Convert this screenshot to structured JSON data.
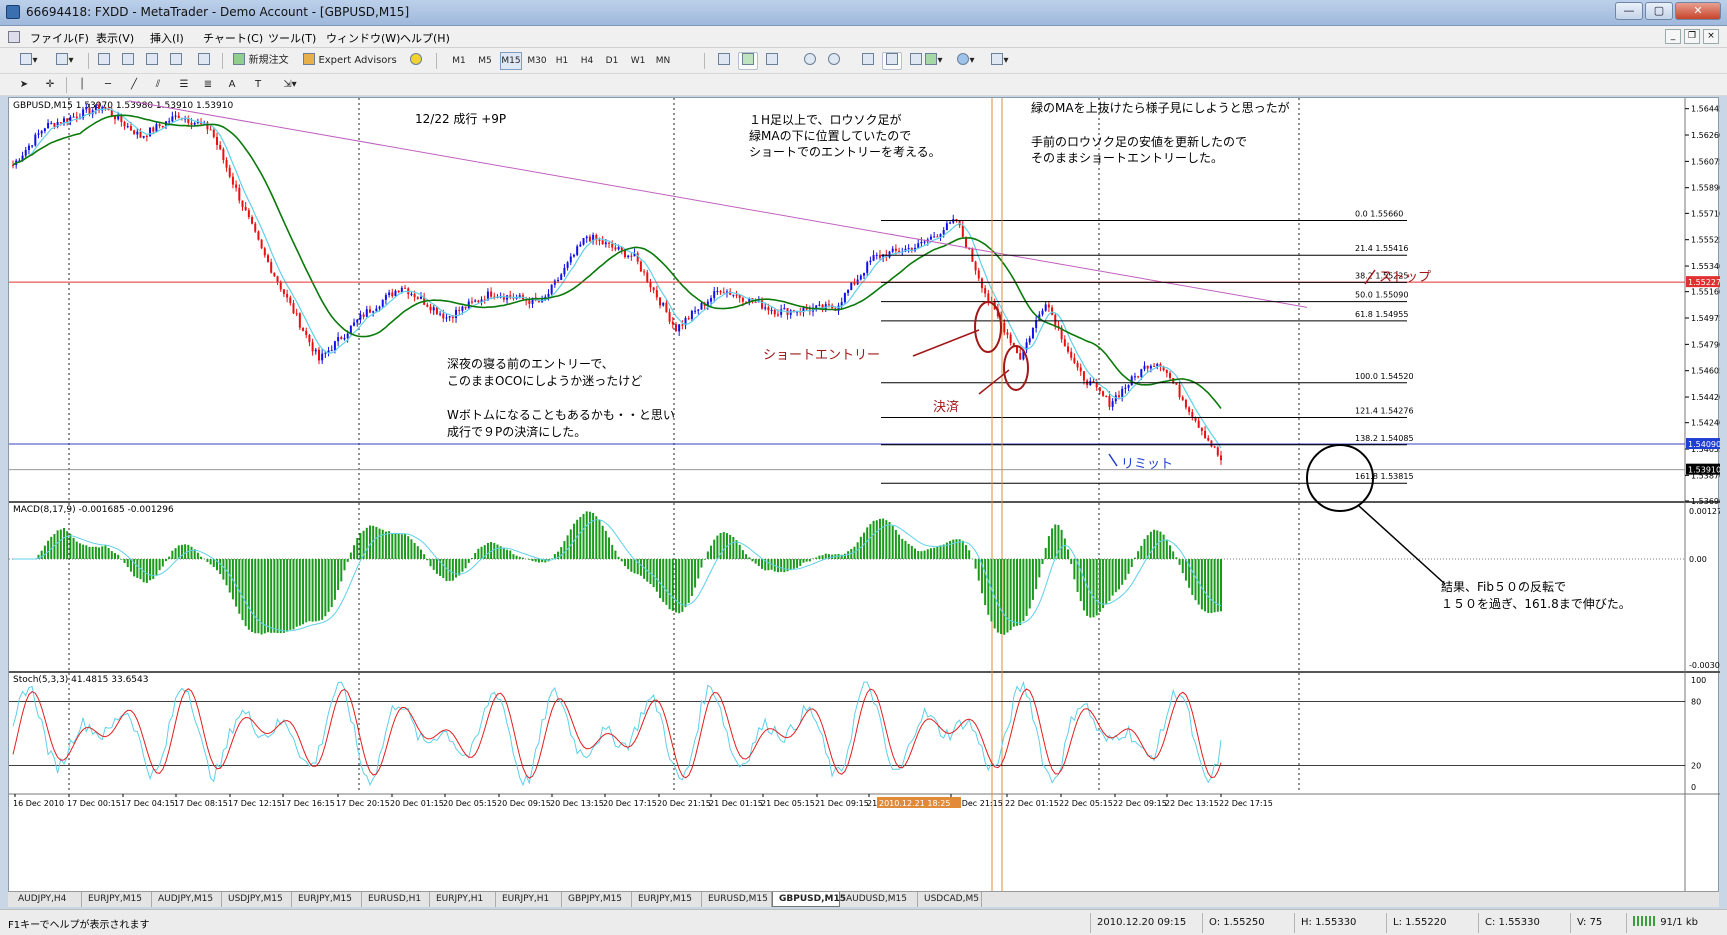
{
  "window": {
    "title": "66694418: FXDD - MetaTrader - Demo Account - [GBPUSD,M15]"
  },
  "menu": [
    "ファイル(F)",
    "表示(V)",
    "挿入(I)",
    "チャート(C)",
    "ツール(T)",
    "ウィンドウ(W)",
    "ヘルプ(H)"
  ],
  "toolbar": {
    "new_order": "新規注文",
    "expert_advisors": "Expert Advisors",
    "timeframes": [
      "M1",
      "M5",
      "M15",
      "M30",
      "H1",
      "H4",
      "D1",
      "W1",
      "MN"
    ],
    "active_timeframe": "M15"
  },
  "chart": {
    "main_header": "GBPUSD,M15  1.53970 1.53980 1.53910 1.53910",
    "macd_header": "MACD(8,17,9) -0.001685 -0.001296",
    "stoch_header": "Stoch(5,3,3) 41.4815 33.6543",
    "price_ticks": [
      "1.56445",
      "1.56260",
      "1.56075",
      "1.55890",
      "1.55710",
      "1.55525",
      "1.55340",
      "1.55160",
      "1.54975",
      "1.54790",
      "1.54605",
      "1.54420",
      "1.54240",
      "1.54055",
      "1.53870",
      "1.53690"
    ],
    "price_tags": {
      "stop": "1.55227",
      "limit": "1.54090",
      "current": "1.53910"
    },
    "macd_ticks": [
      "0.001276",
      "0.00",
      "-0.00302"
    ],
    "stoch_ticks": [
      "100",
      "80",
      "20",
      "0"
    ],
    "fib_levels": [
      {
        "pct": "0.0",
        "price": "1.55660"
      },
      {
        "pct": "21.4",
        "price": "1.55416"
      },
      {
        "pct": "38.2",
        "price": "1.55225"
      },
      {
        "pct": "50.0",
        "price": "1.55090"
      },
      {
        "pct": "61.8",
        "price": "1.54955"
      },
      {
        "pct": "100.0",
        "price": "1.54520"
      },
      {
        "pct": "121.4",
        "price": "1.54276"
      },
      {
        "pct": "138.2",
        "price": "1.54085"
      },
      {
        "pct": "161.8",
        "price": "1.53815"
      }
    ],
    "time_labels": [
      "16 Dec 2010",
      "17 Dec 00:15",
      "17 Dec 04:15",
      "17 Dec 08:15",
      "17 Dec 12:15",
      "17 Dec 16:15",
      "17 Dec 20:15",
      "20 Dec 01:15",
      "20 Dec 05:15",
      "20 Dec 09:15",
      "20 Dec 13:15",
      "20 Dec 17:15",
      "20 Dec 21:15",
      "21 Dec 01:15",
      "21 Dec 05:15",
      "21 Dec 09:15",
      "21 D",
      "22 Dec 21:15",
      "22 Dec 01:15",
      "22 Dec 05:15",
      "22 Dec 09:15",
      "22 Dec 13:15",
      "22 Dec 17:15"
    ],
    "cursor_time": "2010.12.21 18:25",
    "annotations": {
      "date_note": "12/22 成行  +9P",
      "reason": [
        "１H足以上で、ロウソク足が",
        "緑MAの下に位置していたので",
        "ショートでのエントリーを考える。"
      ],
      "plan": "緑のMAを上抜けたら様子見にしようと思ったが",
      "entry_reason": [
        "手前のロウソク足の安値を更新したので",
        "そのままショートエントリーした。"
      ],
      "stop": "ストップ",
      "short_entry": "ショートエントリー",
      "settle": "決済",
      "limit": "リミット",
      "night_note": [
        "深夜の寝る前のエントリーで、",
        "このままOCOにしようか迷ったけど",
        "",
        "Wボトムになることもあるかも・・と思い",
        "成行で９Pの決済にした。"
      ],
      "result": [
        "結果、Fib５０の反転で",
        "１５０を過ぎ、161.8まで伸びた。"
      ]
    }
  },
  "symbol_tabs": [
    "AUDJPY,H4",
    "EURJPY,M15",
    "AUDJPY,M15",
    "USDJPY,M15",
    "EURJPY,M15",
    "EURUSD,H1",
    "EURJPY,H1",
    "EURJPY,H1",
    "GBPJPY,M15",
    "EURJPY,M15",
    "EURUSD,M15",
    "GBPUSD,M15",
    "AUDUSD,M15",
    "USDCAD,M5"
  ],
  "active_symbol_tab": "GBPUSD,M15",
  "status": {
    "help": "F1キーでヘルプが表示されます",
    "datetime": "2010.12.20 09:15",
    "open": "O: 1.55250",
    "high": "H: 1.55330",
    "low": "L: 1.55220",
    "close": "C: 1.55330",
    "volume": "V: 75",
    "traffic": "91/1 kb"
  },
  "colors": {
    "bull": "#1010e8",
    "bear": "#e81010",
    "ma_green": "#0a7a0a",
    "ma_cyan": "#5fd0e8",
    "trend": "#c060c0",
    "macd_bar": "#1a9a1a",
    "annot": "#a01818"
  }
}
